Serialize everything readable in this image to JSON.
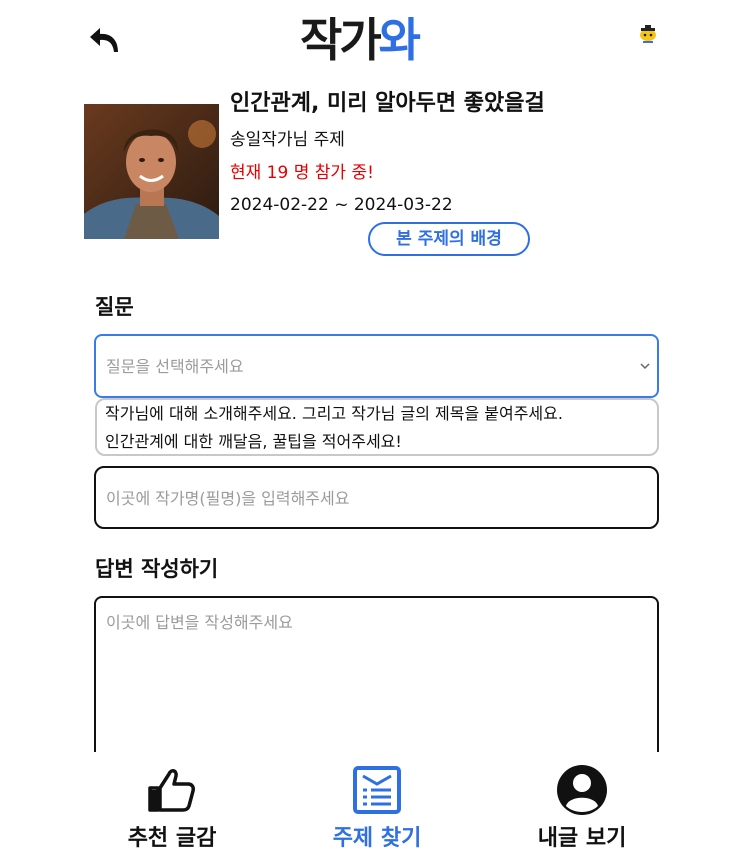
{
  "header": {
    "logo_part1": "작가",
    "logo_part2": "와"
  },
  "topic": {
    "title": "인간관계, 미리 알아두면 좋았을걸",
    "author": "송일작가님 주제",
    "participants": "현재 19 명 참가 중!",
    "dates": "2024-02-22 ~ 2024-03-22",
    "background_button": "본 주제의 배경"
  },
  "question": {
    "label": "질문",
    "placeholder": "질문을 선택해주세요",
    "options": [
      "작가님에 대해 소개해주세요. 그리고 작가님 글의 제목을 붙여주세요.",
      "인간관계에 대한 깨달음, 꿀팁을 적어주세요!"
    ]
  },
  "author_input": {
    "placeholder": "이곳에 작가명(필명)을 입력해주세요"
  },
  "answer": {
    "label": "답변 작성하기",
    "placeholder": "이곳에 답변을 작성해주세요"
  },
  "bottom_nav": {
    "items": [
      {
        "label": "추천 글감",
        "icon": "thumbs-up-icon",
        "color": "#111111"
      },
      {
        "label": "주제 찾기",
        "icon": "document-list-icon",
        "color": "#2f6fe4",
        "active": true
      },
      {
        "label": "내글 보기",
        "icon": "user-circle-icon",
        "color": "#111111"
      }
    ]
  },
  "colors": {
    "accent": "#2f6fe4",
    "alert": "#e60000",
    "placeholder": "#9b9b9b"
  }
}
